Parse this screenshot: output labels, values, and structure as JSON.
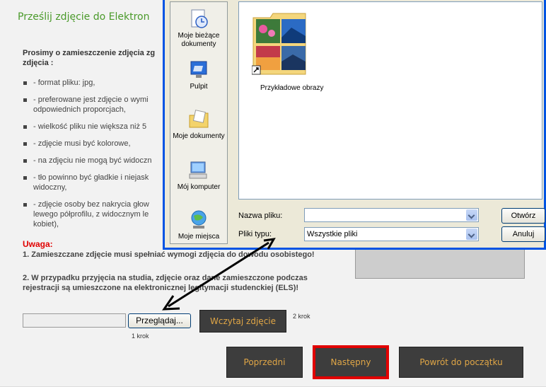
{
  "page": {
    "title": "Prześlij zdjęcie do Elektron",
    "intro": "Prosimy o zamieszczenie zdjęcia zg zdjęcia :",
    "requirements": [
      "- format pliku: jpg,",
      "- preferowane jest zdjęcie o wymi odpowiednich proporcjach,",
      "- wielkość pliku nie większa niż 5",
      "- zdjęcie musi być kolorowe,",
      "- na zdjęciu nie mogą być widoczn",
      "- tło powinno być gładkie i niejask widoczny,",
      "- zdjęcie osoby bez nakrycia głow lewego półprofilu, z widocznym le kobiet),"
    ],
    "uwaga_title": "Uwaga:",
    "uwaga_1": "1. Zamieszczane zdjęcie musi spełniać wymogi zdjęcia do dowodu osobistego!",
    "uwaga_2": "2. W przypadku przyjęcia na studia, zdjęcie oraz dane zamieszczone podczas rejestracji są umieszczone na elektronicznej legitymacji studenckiej (ELS)!",
    "file_path_value": "",
    "browse_label": "Przeglądaj...",
    "step1": "1 krok",
    "load_label": "Wczytaj zdjęcie",
    "step2": "2 krok",
    "prev_label": "Poprzedni",
    "next_label": "Następny",
    "home_label": "Powrót do początku"
  },
  "dialog": {
    "places": [
      {
        "label": "Moje bieżące dokumenty",
        "icon": "recent-documents-icon"
      },
      {
        "label": "Pulpit",
        "icon": "desktop-icon"
      },
      {
        "label": "Moje dokumenty",
        "icon": "my-documents-icon"
      },
      {
        "label": "Mój komputer",
        "icon": "my-computer-icon"
      },
      {
        "label": "Moje miejsca",
        "icon": "network-places-icon"
      }
    ],
    "folder_label": "Przykładowe obrazy",
    "filename_label": "Nazwa pliku:",
    "filename_value": "",
    "filetype_label": "Pliki typu:",
    "filetype_value": "Wszystkie pliki",
    "open_label": "Otwórz",
    "cancel_label": "Anuluj"
  },
  "colors": {
    "title_green": "#4a9a2a",
    "warning_red": "#e00000",
    "button_text": "#e0a646",
    "button_bg": "#3d3d3d",
    "highlight_border": "#e10000",
    "dialog_border": "#0054e3"
  }
}
